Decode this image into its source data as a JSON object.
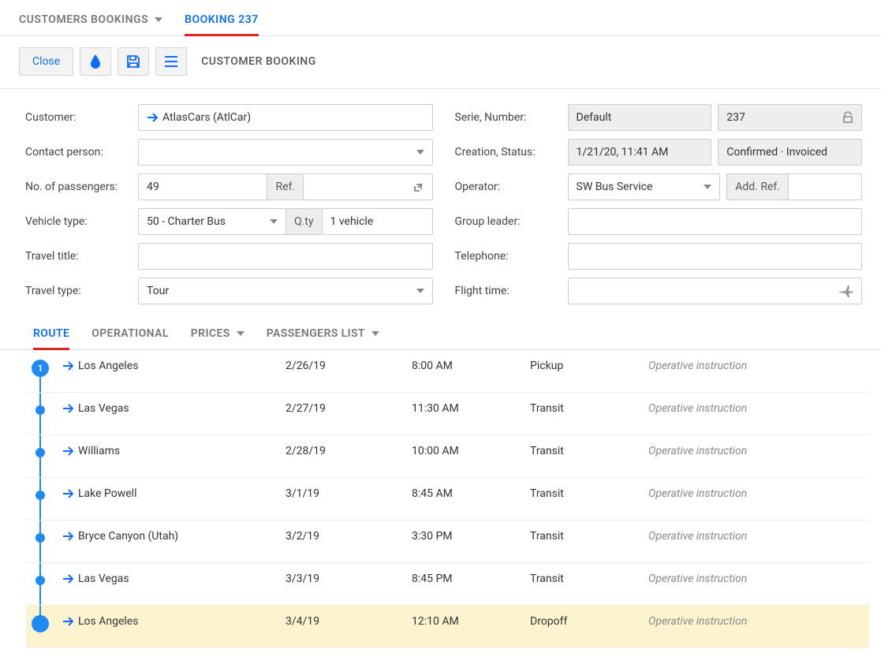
{
  "header": {
    "tab_bookings": "CUSTOMERS BOOKINGS",
    "tab_booking": "BOOKING 237"
  },
  "toolbar": {
    "close": "Close",
    "title": "CUSTOMER BOOKING"
  },
  "form": {
    "left": {
      "customer_label": "Customer:",
      "customer_value": "AtlasCars (AtlCar)",
      "contact_label": "Contact person:",
      "contact_value": "",
      "passengers_label": "No. of passengers:",
      "passengers_value": "49",
      "ref_label": "Ref.",
      "ref_value": "",
      "vehicle_label": "Vehicle type:",
      "vehicle_value": "50 - Charter Bus",
      "qty_label": "Q.ty",
      "qty_value": "1 vehicle",
      "title_label": "Travel title:",
      "title_value": "",
      "type_label": "Travel type:",
      "type_value": "Tour"
    },
    "right": {
      "serie_label": "Serie, Number:",
      "serie_value": "Default",
      "number_value": "237",
      "creation_label": "Creation, Status:",
      "creation_value": "1/21/20, 11:41 AM",
      "status_value": "Confirmed · Invoiced",
      "operator_label": "Operator:",
      "operator_value": "SW Bus Service",
      "addref_label": "Add. Ref.",
      "addref_value": "",
      "leader_label": "Group leader:",
      "leader_value": "",
      "phone_label": "Telephone:",
      "phone_value": "",
      "flight_label": "Flight time:",
      "flight_value": ""
    }
  },
  "subtabs": {
    "route": "ROUTE",
    "operational": "OPERATIONAL",
    "prices": "PRICES",
    "passengers": "PASSENGERS LIST"
  },
  "route": {
    "instr_placeholder": "Operative instruction",
    "stops": [
      {
        "num": "1",
        "loc": "Los Angeles",
        "date": "2/26/19",
        "time": "8:00 AM",
        "type": "Pickup"
      },
      {
        "num": "",
        "loc": "Las Vegas",
        "date": "2/27/19",
        "time": "11:30 AM",
        "type": "Transit"
      },
      {
        "num": "",
        "loc": "Williams",
        "date": "2/28/19",
        "time": "10:00 AM",
        "type": "Transit"
      },
      {
        "num": "",
        "loc": "Lake Powell",
        "date": "3/1/19",
        "time": "8:45 AM",
        "type": "Transit"
      },
      {
        "num": "",
        "loc": "Bryce Canyon (Utah)",
        "date": "3/2/19",
        "time": "3:30 PM",
        "type": "Transit"
      },
      {
        "num": "",
        "loc": "Las Vegas",
        "date": "3/3/19",
        "time": "8:45 PM",
        "type": "Transit"
      },
      {
        "num": "",
        "loc": "Los Angeles",
        "date": "3/4/19",
        "time": "12:10 AM",
        "type": "Dropoff"
      }
    ]
  }
}
